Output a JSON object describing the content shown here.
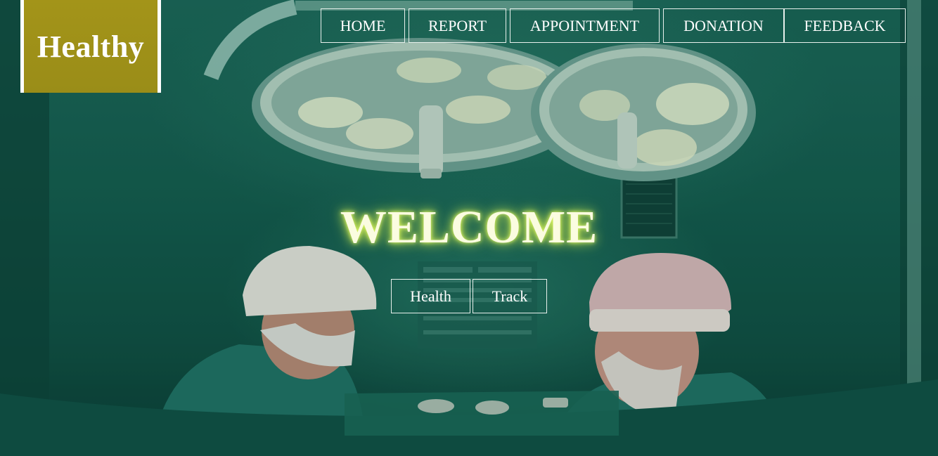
{
  "brand": {
    "name": "Healthy"
  },
  "nav": {
    "items": [
      {
        "label": "HOME"
      },
      {
        "label": "REPORT"
      },
      {
        "label": "APPOINTMENT"
      },
      {
        "label": "DONATION"
      },
      {
        "label": "FEEDBACK"
      }
    ]
  },
  "hero": {
    "heading": "WELCOME",
    "buttons": [
      {
        "label": "Health"
      },
      {
        "label": "Track"
      }
    ]
  },
  "colors": {
    "logo_background": "#a39419",
    "overlay_green": "#145a4c",
    "heading_glow": "#eaff6a",
    "border_white": "#ffffff"
  },
  "background_image": {
    "icon": "operating-room-photo"
  }
}
